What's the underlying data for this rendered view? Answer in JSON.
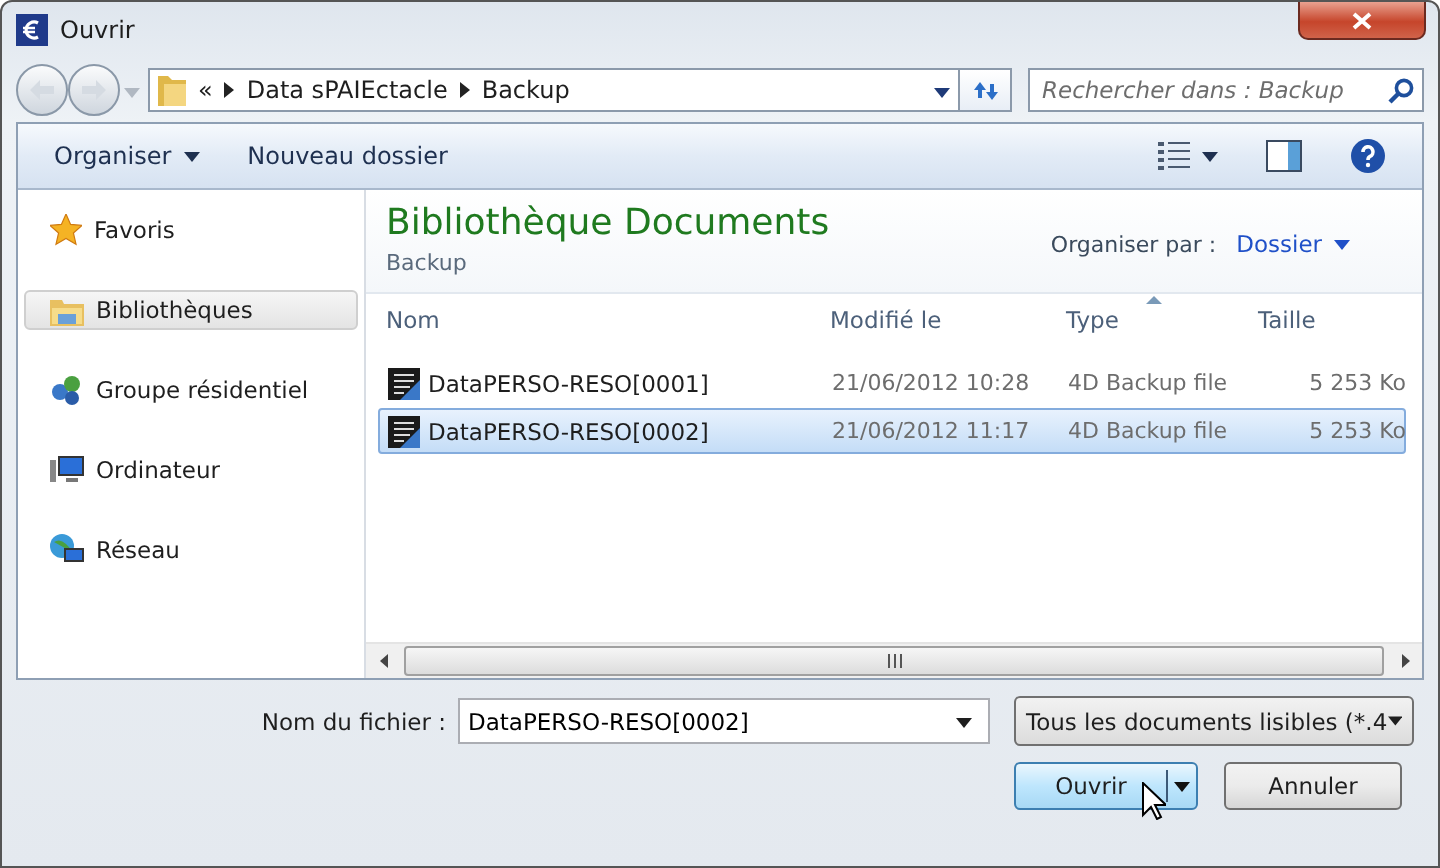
{
  "window": {
    "title": "Ouvrir"
  },
  "address_bar": {
    "crumbs": [
      "«",
      "Data sPAIEctacle",
      "Backup"
    ]
  },
  "search": {
    "placeholder": "Rechercher dans : Backup"
  },
  "toolbar": [
    {
      "label": "Organiser",
      "has_menu": true
    },
    {
      "label": "Nouveau dossier",
      "has_menu": false
    }
  ],
  "sidebar": {
    "items": [
      {
        "label": "Favoris",
        "kind": "favorites",
        "selected": false
      },
      {
        "label": "Bibliothèques",
        "kind": "libraries",
        "selected": true
      },
      {
        "label": "Groupe résidentiel",
        "kind": "homegroup",
        "selected": false
      },
      {
        "label": "Ordinateur",
        "kind": "computer",
        "selected": false
      },
      {
        "label": "Réseau",
        "kind": "network",
        "selected": false
      }
    ]
  },
  "library": {
    "title": "Bibliothèque Documents",
    "subtitle": "Backup",
    "arrange_label": "Organiser par :",
    "arrange_value": "Dossier"
  },
  "table": {
    "columns": [
      {
        "label": "Nom",
        "sorted": false
      },
      {
        "label": "Modifié le",
        "sorted": false
      },
      {
        "label": "Type",
        "sorted": true
      },
      {
        "label": "Taille",
        "sorted": false
      }
    ],
    "rows": [
      {
        "name": "DataPERSO-RESO[0001]",
        "modified": "21/06/2012 10:28",
        "type": "4D Backup file",
        "size": "5 253 Ko",
        "selected": false
      },
      {
        "name": "DataPERSO-RESO[0002]",
        "modified": "21/06/2012 11:17",
        "type": "4D Backup file",
        "size": "5 253 Ko",
        "selected": true
      }
    ]
  },
  "footer": {
    "filename_label": "Nom du fichier :",
    "filename": "DataPERSO-RESO[0002]",
    "filter": "Tous les documents lisibles (*.4",
    "buttons": [
      {
        "label": "Ouvrir",
        "kind": "split",
        "default": true
      },
      {
        "label": "Annuler",
        "kind": "plain",
        "default": false
      }
    ]
  }
}
